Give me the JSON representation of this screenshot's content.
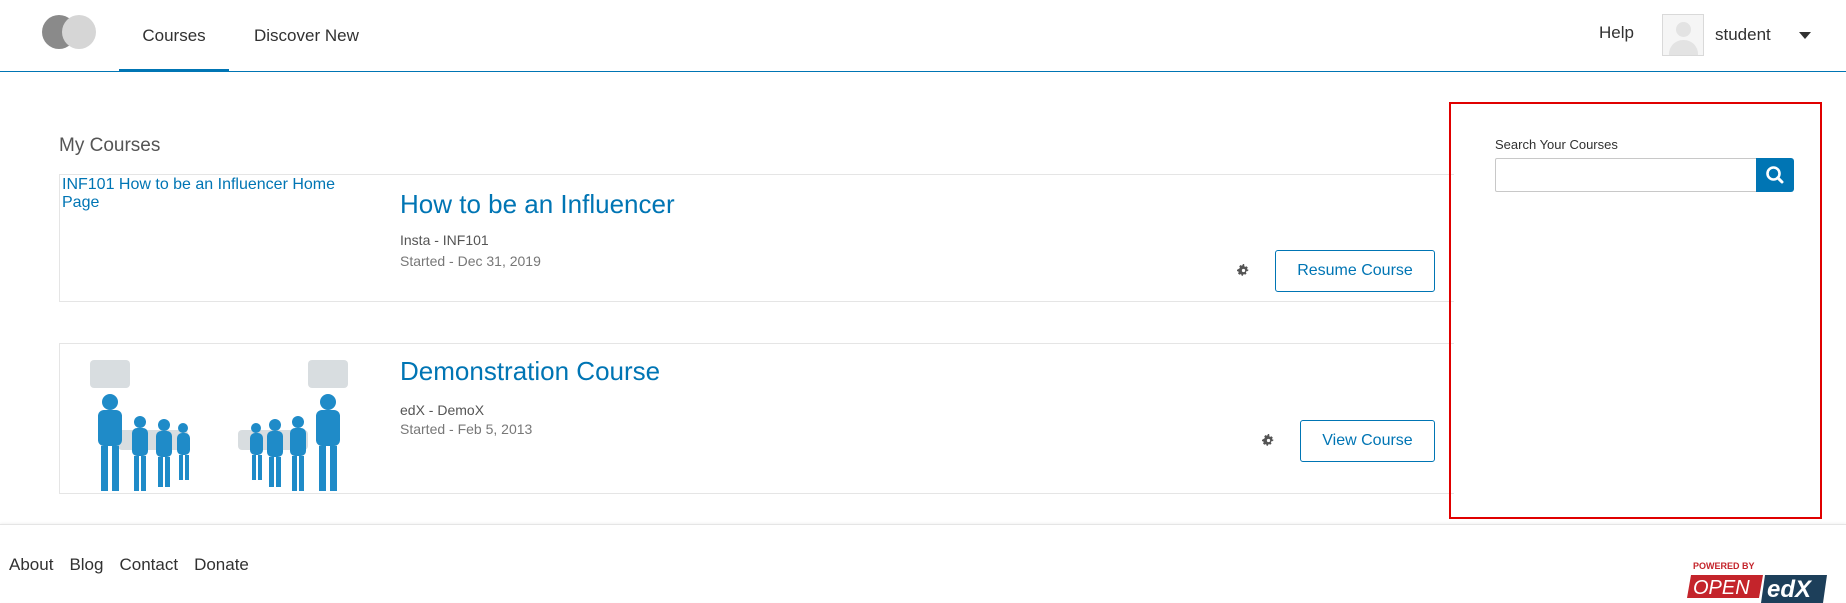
{
  "header": {
    "nav": [
      "Courses",
      "Discover New"
    ],
    "help": "Help",
    "username": "student"
  },
  "main": {
    "section_title": "My Courses",
    "courses": [
      {
        "image_alt": "INF101 How to be an Influencer Home Page",
        "title": "How to be an Influencer",
        "org": "Insta - INF101",
        "started": "Started - Dec 31, 2019",
        "button": "Resume Course"
      },
      {
        "title": "Demonstration Course",
        "org": "edX - DemoX",
        "started": "Started - Feb 5, 2013",
        "button": "View Course"
      }
    ]
  },
  "sidebar": {
    "search_label": "Search Your Courses",
    "search_value": ""
  },
  "footer": {
    "links": [
      "About",
      "Blog",
      "Contact",
      "Donate"
    ],
    "powered_by": "POWERED BY",
    "brand_open": "OPEN",
    "brand_edx": "edX"
  },
  "colors": {
    "accent": "#0075b4",
    "highlight_border": "#e00000",
    "brand_red": "#c4242b"
  }
}
